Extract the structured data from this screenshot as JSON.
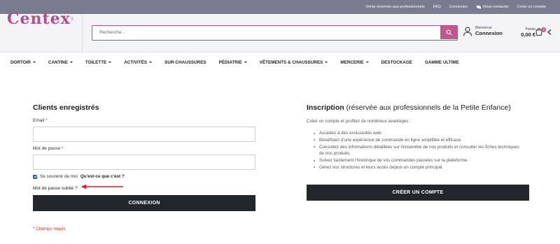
{
  "topbar": {
    "links": [
      "Vente réservée aux professionnels",
      "FAQ",
      "Connexion",
      "Nous contacter",
      "Créer un compte"
    ]
  },
  "brand": {
    "logo_text": "Centex",
    "accent_color": "#c2578e"
  },
  "search": {
    "placeholder": "Recherche..."
  },
  "account": {
    "greeting": "Bienvenue",
    "label": "Connexion"
  },
  "cart": {
    "label": "Panier",
    "total": "0,00 €",
    "count": "0"
  },
  "nav": {
    "items": [
      "DORTOIR",
      "CANTINE",
      "TOILETTE",
      "ACTIVITÉS",
      "SUR-CHAUSSURES",
      "PÉDIATRIE",
      "VÊTEMENTS & CHAUSSURES",
      "MERCERIE",
      "DESTOCKAGE",
      "GAMME ULTIME"
    ]
  },
  "login": {
    "title": "Clients enregistrés",
    "email_label": "Email",
    "password_label": "Mot de passe",
    "required_mark": "*",
    "remember_text": "Se souvenir de moi",
    "remember_link": "Qu'est-ce que c'est ?",
    "forgot": "Mot de passe oublié ?",
    "submit": "CONNEXION",
    "required_note": "* Champs requis"
  },
  "signup": {
    "title": "Inscription",
    "subtitle": "(réservée aux professionnels de la Petite Enfance)",
    "intro": "Créer un compte et profitez de nombreux avantages :",
    "benefits": [
      "Accédez à des exclusivités web.",
      "Bénéficiez d'une expérience de commande en ligne simplifiée et efficace.",
      "Consultez des informations détaillées sur l'ensemble de nos produits et consulter les fiches techniques de nos produits.",
      "Suivez facilement l'historique de vos commandes passées sur la plateforme.",
      "Gérez vos structures et leurs accès depuis un compte principal."
    ],
    "submit": "CRÉER UN COMPTE"
  }
}
